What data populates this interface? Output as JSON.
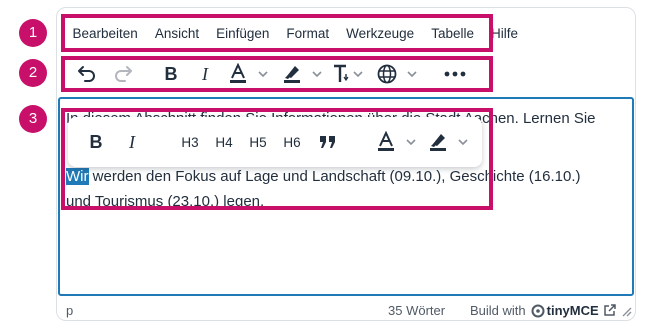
{
  "badges": [
    "1",
    "2",
    "3"
  ],
  "menubar": {
    "items": [
      "Bearbeiten",
      "Ansicht",
      "Einfügen",
      "Format",
      "Werkzeuge",
      "Tabelle",
      "Hilfe"
    ]
  },
  "toolbar": {
    "icons": [
      "undo-icon",
      "redo-icon",
      "bold-icon",
      "italic-icon",
      "text-color-icon",
      "chevron-down-icon",
      "highlight-icon",
      "chevron-down-icon",
      "font-size-icon",
      "chevron-down-icon",
      "language-globe-icon",
      "chevron-down-icon",
      "more-icon"
    ],
    "bold_label": "B",
    "italic_label": "I"
  },
  "quickbar": {
    "bold_label": "B",
    "italic_label": "I",
    "headings": [
      "H3",
      "H4",
      "H5",
      "H6"
    ],
    "icons": [
      "blockquote-icon",
      "text-color-icon",
      "chevron-down-icon",
      "highlight-icon",
      "chevron-down-icon"
    ]
  },
  "content": {
    "line1": "In diesem Abschnitt finden Sie Informationen über die Stadt Aachen. Lernen Sie",
    "selected": "Wir",
    "line2_rest": " werden den Fokus auf Lage und Landschaft (09.10.), Geschichte (16.10.)",
    "line3": "und Tourismus (23.10.) legen."
  },
  "statusbar": {
    "path": "p",
    "word_count": "35 Wörter",
    "build_with": "Build with",
    "brand": "tinyMCE"
  },
  "colors": {
    "accent": "#c8106a",
    "selection": "#207ab7",
    "text": "#222f3e"
  }
}
